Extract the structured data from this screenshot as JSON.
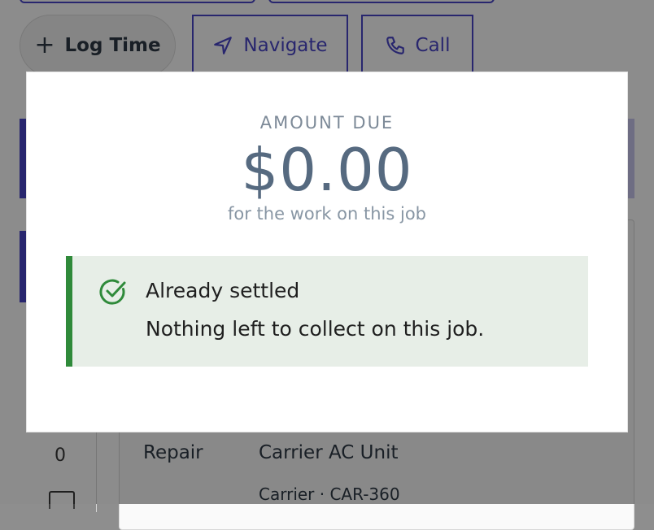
{
  "background": {
    "actions": {
      "log_time_label": "Log Time",
      "navigate_label": "Navigate",
      "call_label": "Call"
    },
    "side_count": "0",
    "job": {
      "type": "Repair",
      "unit": "Carrier AC Unit",
      "model": "Carrier · CAR-360"
    }
  },
  "modal": {
    "amount_label": "AMOUNT DUE",
    "amount_value": "$0.00",
    "amount_sub": "for the work on this job",
    "notice": {
      "title": "Already settled",
      "message": "Nothing left to collect on this job.",
      "icon": "check-circle-icon",
      "accent_color": "#2f8a3a"
    }
  },
  "colors": {
    "brand": "#4a45c8",
    "amount_text": "#566a80",
    "success": "#2f8a3a"
  }
}
